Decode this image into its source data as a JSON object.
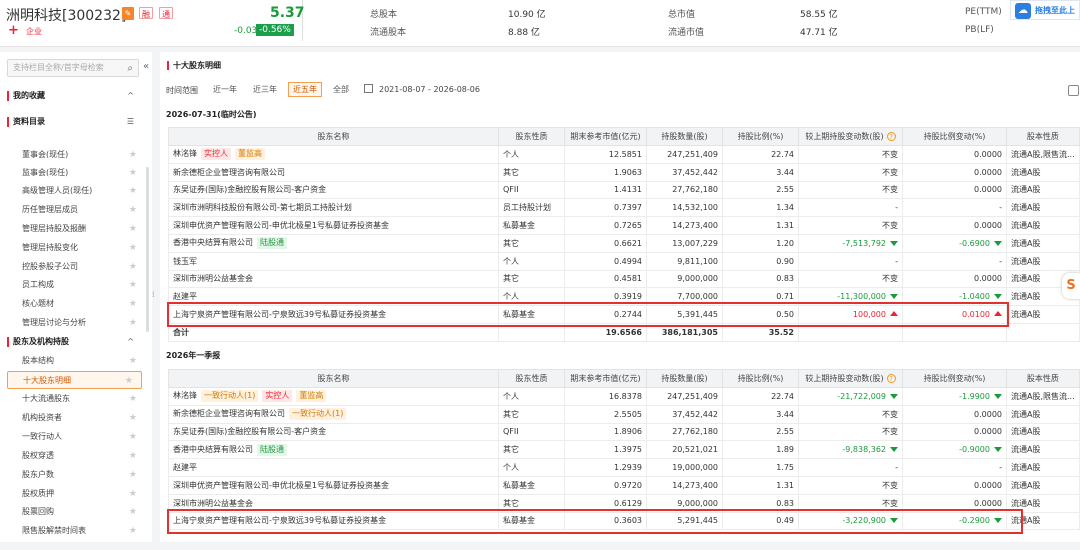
{
  "header": {
    "stock_name": "洲明科技[300232]",
    "edit_icon": "edit-icon",
    "tag_rong": "融",
    "tag_tong": "通",
    "plus_symbol": "+",
    "business": "企业",
    "price": "5.37",
    "change": "-0.03",
    "change_pct": "-0.56%",
    "quote_items": [
      {
        "label": "总股本",
        "value": "10.90 亿"
      },
      {
        "label": "流通股本",
        "value": "8.88 亿"
      },
      {
        "label": "总市值",
        "value": "58.55 亿"
      },
      {
        "label": "流通市值",
        "value": "47.71 亿"
      },
      {
        "label": "PE(TTM)",
        "value": ""
      },
      {
        "label": "PB(LF)",
        "value": ""
      }
    ],
    "drag_button": "拖拽至此上"
  },
  "sidebar": {
    "search_placeholder": "支持栏目全称/首字母检索",
    "favorites_label": "我的收藏",
    "directory_label": "资料目录",
    "mgmt_items": [
      "董事会(现任)",
      "监事会(现任)",
      "高级管理人员(现任)",
      "历任管理层成员",
      "管理层持股及报酬",
      "管理层持股变化",
      "控股参股子公司",
      "员工构成",
      "核心题材",
      "管理层讨论与分析"
    ],
    "holders_section": "股东及机构持股",
    "holder_items": [
      "股本结构",
      "十大股东明细",
      "十大流通股东",
      "机构投资者",
      "一致行动人",
      "股权穿透",
      "股东户数",
      "股权质押",
      "股票回购",
      "限售股解禁时间表"
    ]
  },
  "main": {
    "title": "十大股东明细",
    "time_range_label": "时间范围",
    "time_buttons": [
      "近一年",
      "近三年",
      "近五年",
      "全部"
    ],
    "date_range": "2021-08-07  -  2026-08-06",
    "columns": [
      "股东名称",
      "股东性质",
      "期末参考市值(亿元)",
      "持股数量(股)",
      "持股比例(%)",
      "较上期持股变动数(股)",
      "持股比例变动(%)",
      "股本性质"
    ],
    "period1": {
      "title": "2026-07-31(临时公告)",
      "rows": [
        {
          "name": "林洺锋",
          "badges": [
            {
              "text": "实控人",
              "c": "r"
            },
            {
              "text": "董监高",
              "c": "o"
            }
          ],
          "nature": "个人",
          "mv": "12.5851",
          "shares": "247,251,409",
          "ratio": "22.74",
          "chg": "不变",
          "chg_dir": "",
          "rchg": "0.0000",
          "rchg_dir": "",
          "stype": "流通A股,限售流..."
        },
        {
          "name": "新余德柜企业管理咨询有限公司",
          "badges": [],
          "nature": "其它",
          "mv": "1.9063",
          "shares": "37,452,442",
          "ratio": "3.44",
          "chg": "不变",
          "chg_dir": "",
          "rchg": "0.0000",
          "rchg_dir": "",
          "stype": "流通A股"
        },
        {
          "name": "东吴证券(国际)金融控股有限公司-客户资金",
          "badges": [],
          "nature": "QFII",
          "mv": "1.4131",
          "shares": "27,762,180",
          "ratio": "2.55",
          "chg": "不变",
          "chg_dir": "",
          "rchg": "0.0000",
          "rchg_dir": "",
          "stype": "流通A股"
        },
        {
          "name": "深圳市洲明科技股份有限公司-第七期员工持股计划",
          "badges": [],
          "nature": "员工持股计划",
          "mv": "0.7397",
          "shares": "14,532,100",
          "ratio": "1.34",
          "chg": "-",
          "chg_dir": "",
          "rchg": "-",
          "rchg_dir": "",
          "stype": "流通A股"
        },
        {
          "name": "深圳申优资产管理有限公司-申优北极星1号私募证券投资基金",
          "badges": [],
          "nature": "私募基金",
          "mv": "0.7265",
          "shares": "14,273,400",
          "ratio": "1.31",
          "chg": "不变",
          "chg_dir": "",
          "rchg": "0.0000",
          "rchg_dir": "",
          "stype": "流通A股"
        },
        {
          "name": "香港中央结算有限公司",
          "badges": [
            {
              "text": "陆股通",
              "c": "g"
            }
          ],
          "nature": "其它",
          "mv": "0.6621",
          "shares": "13,007,229",
          "ratio": "1.20",
          "chg": "-7,513,792",
          "chg_dir": "dn",
          "rchg": "-0.6900",
          "rchg_dir": "dn",
          "stype": "流通A股"
        },
        {
          "name": "钱玉军",
          "badges": [],
          "nature": "个人",
          "mv": "0.4994",
          "shares": "9,811,100",
          "ratio": "0.90",
          "chg": "-",
          "chg_dir": "",
          "rchg": "-",
          "rchg_dir": "",
          "stype": "流通A股"
        },
        {
          "name": "深圳市洲明公益基金会",
          "badges": [],
          "nature": "其它",
          "mv": "0.4581",
          "shares": "9,000,000",
          "ratio": "0.83",
          "chg": "不变",
          "chg_dir": "",
          "rchg": "0.0000",
          "rchg_dir": "",
          "stype": "流通A股"
        },
        {
          "name": "赵建平",
          "badges": [],
          "nature": "个人",
          "mv": "0.3919",
          "shares": "7,700,000",
          "ratio": "0.71",
          "chg": "-11,300,000",
          "chg_dir": "dn",
          "rchg": "-1.0400",
          "rchg_dir": "dn",
          "stype": "流通A股"
        },
        {
          "name": "上海宁泉资产管理有限公司-宁泉致远39号私募证券投资基金",
          "badges": [],
          "nature": "私募基金",
          "mv": "0.2744",
          "shares": "5,391,445",
          "ratio": "0.50",
          "chg": "100,000",
          "chg_dir": "up",
          "rchg": "0.0100",
          "rchg_dir": "up",
          "stype": "流通A股"
        }
      ],
      "total": {
        "label": "合计",
        "mv": "19.6566",
        "shares": "386,181,305",
        "ratio": "35.52"
      }
    },
    "period2": {
      "title": "2026年一季报",
      "rows": [
        {
          "name": "林洺锋",
          "badges": [
            {
              "text": "一致行动人(1)",
              "c": "o"
            },
            {
              "text": "实控人",
              "c": "r"
            },
            {
              "text": "董监高",
              "c": "o"
            }
          ],
          "nature": "个人",
          "mv": "16.8378",
          "shares": "247,251,409",
          "ratio": "22.74",
          "chg": "-21,722,009",
          "chg_dir": "dn",
          "rchg": "-1.9900",
          "rchg_dir": "dn",
          "stype": "流通A股,限售流..."
        },
        {
          "name": "新余德柜企业管理咨询有限公司",
          "badges": [
            {
              "text": "一致行动人(1)",
              "c": "o"
            }
          ],
          "nature": "其它",
          "mv": "2.5505",
          "shares": "37,452,442",
          "ratio": "3.44",
          "chg": "不变",
          "chg_dir": "",
          "rchg": "0.0000",
          "rchg_dir": "",
          "stype": "流通A股"
        },
        {
          "name": "东吴证券(国际)金融控股有限公司-客户资金",
          "badges": [],
          "nature": "QFII",
          "mv": "1.8906",
          "shares": "27,762,180",
          "ratio": "2.55",
          "chg": "不变",
          "chg_dir": "",
          "rchg": "0.0000",
          "rchg_dir": "",
          "stype": "流通A股"
        },
        {
          "name": "香港中央结算有限公司",
          "badges": [
            {
              "text": "陆股通",
              "c": "g"
            }
          ],
          "nature": "其它",
          "mv": "1.3975",
          "shares": "20,521,021",
          "ratio": "1.89",
          "chg": "-9,838,362",
          "chg_dir": "dn",
          "rchg": "-0.9000",
          "rchg_dir": "dn",
          "stype": "流通A股"
        },
        {
          "name": "赵建平",
          "badges": [],
          "nature": "个人",
          "mv": "1.2939",
          "shares": "19,000,000",
          "ratio": "1.75",
          "chg": "-",
          "chg_dir": "",
          "rchg": "-",
          "rchg_dir": "",
          "stype": "流通A股"
        },
        {
          "name": "深圳申优资产管理有限公司-申优北极星1号私募证券投资基金",
          "badges": [],
          "nature": "私募基金",
          "mv": "0.9720",
          "shares": "14,273,400",
          "ratio": "1.31",
          "chg": "不变",
          "chg_dir": "",
          "rchg": "0.0000",
          "rchg_dir": "",
          "stype": "流通A股"
        },
        {
          "name": "深圳市洲明公益基金会",
          "badges": [],
          "nature": "其它",
          "mv": "0.6129",
          "shares": "9,000,000",
          "ratio": "0.83",
          "chg": "不变",
          "chg_dir": "",
          "rchg": "0.0000",
          "rchg_dir": "",
          "stype": "流通A股"
        },
        {
          "name": "上海宁泉资产管理有限公司-宁泉致远39号私募证券投资基金",
          "badges": [],
          "nature": "私募基金",
          "mv": "0.3603",
          "shares": "5,291,445",
          "ratio": "0.49",
          "chg": "-3,220,900",
          "chg_dir": "dn",
          "rchg": "-0.2900",
          "rchg_dir": "dn",
          "stype": "流通A股"
        }
      ]
    }
  }
}
